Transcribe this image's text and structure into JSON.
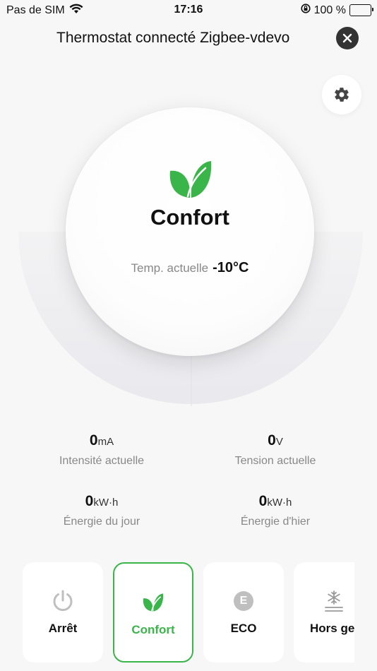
{
  "status_bar": {
    "carrier": "Pas de SIM",
    "time": "17:16",
    "battery_percent": "100 %",
    "icons": [
      "wifi-icon",
      "orientation-lock-icon",
      "battery-icon"
    ]
  },
  "header": {
    "title": "Thermostat connecté Zigbee-vdevo"
  },
  "thermostat": {
    "mode": "Confort",
    "temp_label": "Temp. actuelle",
    "temp_value": "-10°C",
    "icon": "leaf-icon"
  },
  "stats": {
    "current_intensity": {
      "value": "0",
      "unit": "mA",
      "label": "Intensité actuelle"
    },
    "current_voltage": {
      "value": "0",
      "unit": "V",
      "label": "Tension actuelle"
    },
    "energy_today": {
      "value": "0",
      "unit": "kW·h",
      "label": "Énergie du jour"
    },
    "energy_yesterday": {
      "value": "0",
      "unit": "kW·h",
      "label": "Énergie d'hier"
    }
  },
  "modes": [
    {
      "label": "Arrêt",
      "icon": "power-icon",
      "active": false
    },
    {
      "label": "Confort",
      "icon": "leaf-icon",
      "active": true
    },
    {
      "label": "ECO",
      "icon": "eco-icon",
      "badge": "E",
      "active": false
    },
    {
      "label": "Hors gel",
      "icon": "snowflake-icon",
      "active": false
    }
  ],
  "colors": {
    "accent": "#3ab54a",
    "background": "#f7f7f7",
    "inactive_icon": "#bfbfbf"
  }
}
